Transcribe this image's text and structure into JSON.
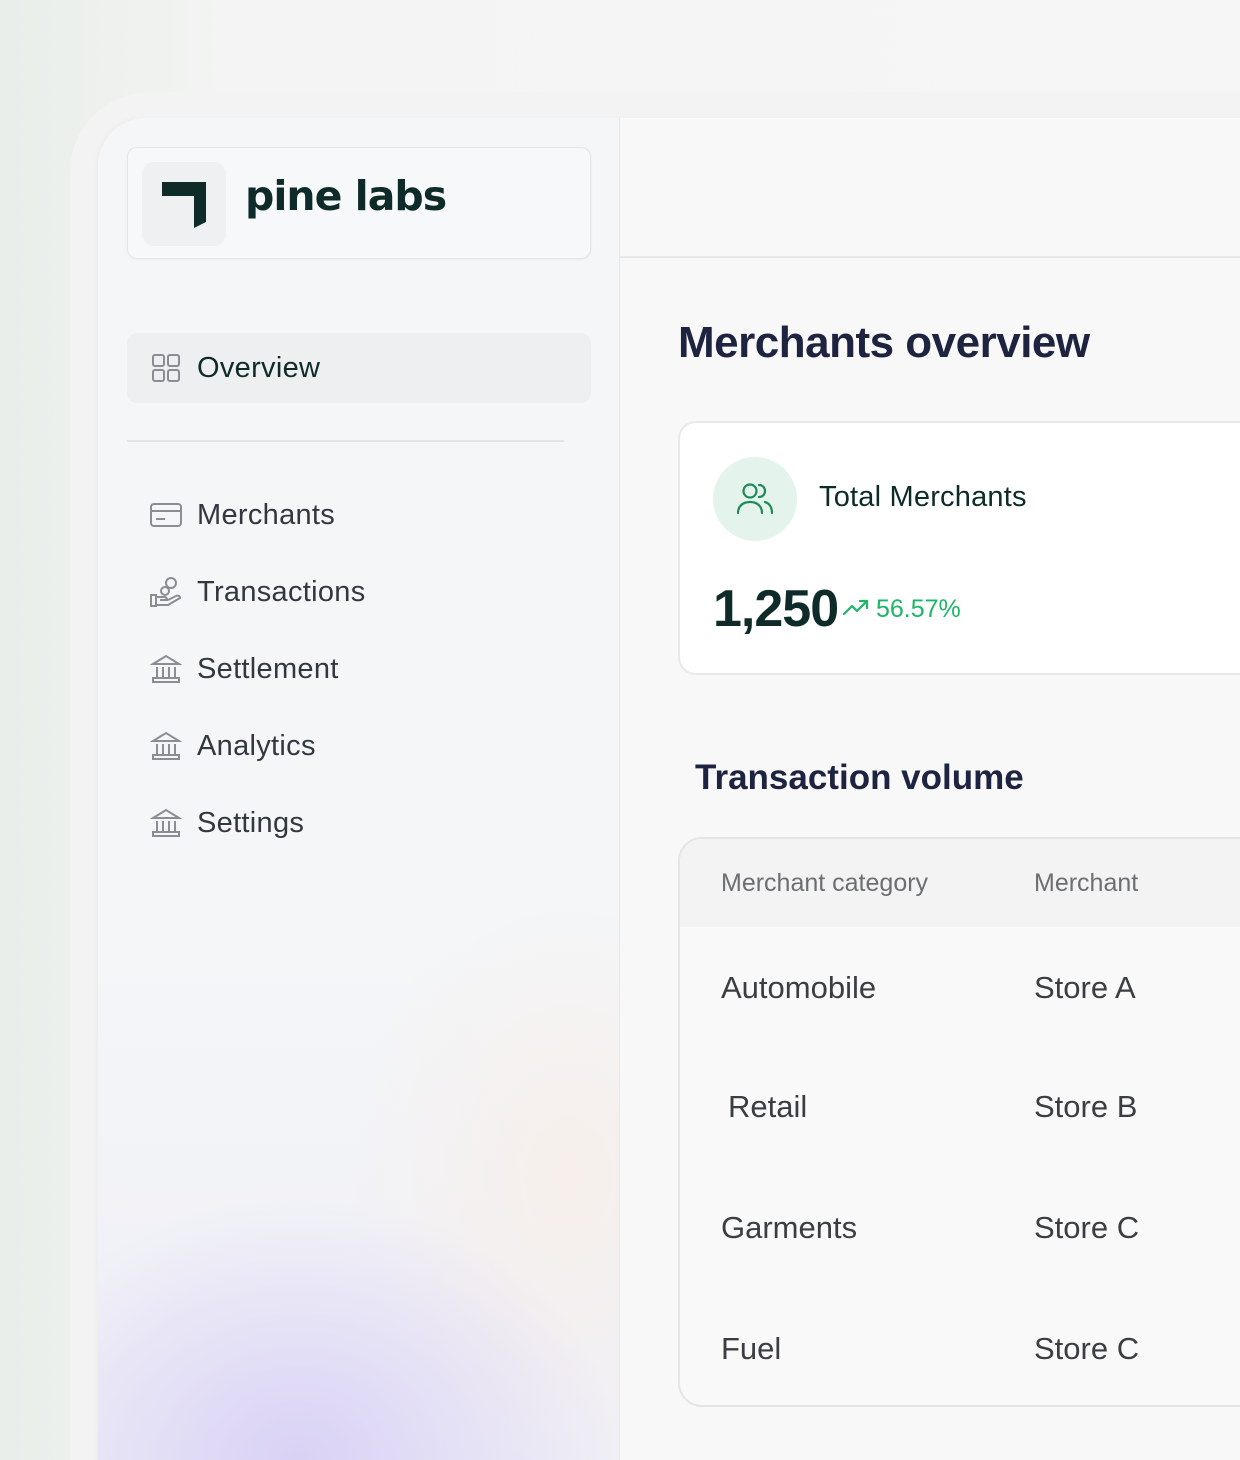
{
  "brand": {
    "name": "pine labs",
    "accent": "#0e2b2a",
    "positive": "#1eb566"
  },
  "sidebar": {
    "active_item": {
      "label": "Overview",
      "icon": "grid-icon"
    },
    "items": [
      {
        "label": "Merchants",
        "icon": "card-icon"
      },
      {
        "label": "Transactions",
        "icon": "hand-coins-icon"
      },
      {
        "label": "Settlement",
        "icon": "bank-icon"
      },
      {
        "label": "Analytics",
        "icon": "bank-icon"
      },
      {
        "label": "Settings",
        "icon": "bank-icon"
      }
    ]
  },
  "main": {
    "title": "Merchants overview",
    "stat": {
      "label": "Total Merchants",
      "value": "1,250",
      "trend": "56.57%",
      "icon": "users-icon"
    },
    "table": {
      "title": "Transaction volume",
      "columns": [
        "Merchant category",
        "Merchant"
      ],
      "rows": [
        [
          "Automobile",
          "Store A"
        ],
        [
          "Retail",
          "Store B"
        ],
        [
          "Garments",
          "Store C"
        ],
        [
          "Fuel",
          "Store C"
        ]
      ]
    }
  }
}
